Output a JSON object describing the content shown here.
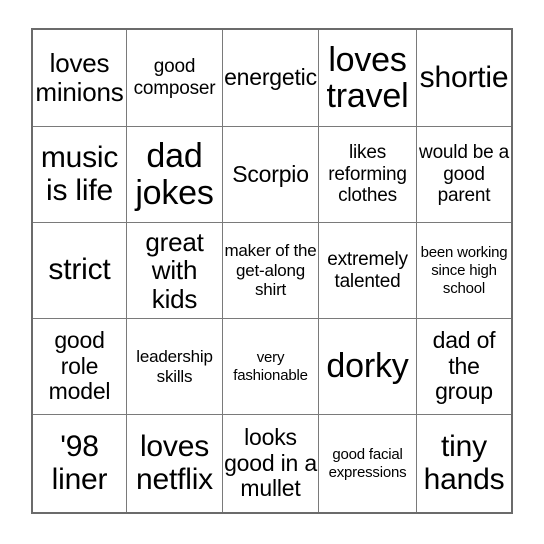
{
  "card": {
    "type": "bingo-card",
    "rows": 5,
    "columns": 5,
    "border_color": "#6b6b6b",
    "grid_line_color": "#7a7a7a",
    "background_color": "#ffffff",
    "text_color": "#000000",
    "cells": [
      {
        "text": "loves minions",
        "size": "fs-ml"
      },
      {
        "text": "good composer",
        "size": "fs-sm"
      },
      {
        "text": "energetic",
        "size": "fs-md"
      },
      {
        "text": "loves travel",
        "size": "fs-xl"
      },
      {
        "text": "shortie",
        "size": "fs-lg"
      },
      {
        "text": "music is life",
        "size": "fs-lg"
      },
      {
        "text": "dad jokes",
        "size": "fs-xl"
      },
      {
        "text": "Scorpio",
        "size": "fs-md"
      },
      {
        "text": "likes reforming clothes",
        "size": "fs-sm"
      },
      {
        "text": "would be a good parent",
        "size": "fs-sm"
      },
      {
        "text": "strict",
        "size": "fs-lg"
      },
      {
        "text": "great with kids",
        "size": "fs-ml"
      },
      {
        "text": "maker of the get-along shirt",
        "size": "fs-xs"
      },
      {
        "text": "extremely talented",
        "size": "fs-sm"
      },
      {
        "text": "been working since high school",
        "size": "fs-xxs"
      },
      {
        "text": "good role model",
        "size": "fs-md"
      },
      {
        "text": "leadership skills",
        "size": "fs-xs"
      },
      {
        "text": "very fashionable",
        "size": "fs-xxs"
      },
      {
        "text": "dorky",
        "size": "fs-xl"
      },
      {
        "text": "dad of the group",
        "size": "fs-md"
      },
      {
        "text": "'98 liner",
        "size": "fs-lg"
      },
      {
        "text": "loves netflix",
        "size": "fs-lg"
      },
      {
        "text": "looks good in a mullet",
        "size": "fs-md"
      },
      {
        "text": "good facial expressions",
        "size": "fs-xxs"
      },
      {
        "text": "tiny hands",
        "size": "fs-lg"
      }
    ]
  }
}
